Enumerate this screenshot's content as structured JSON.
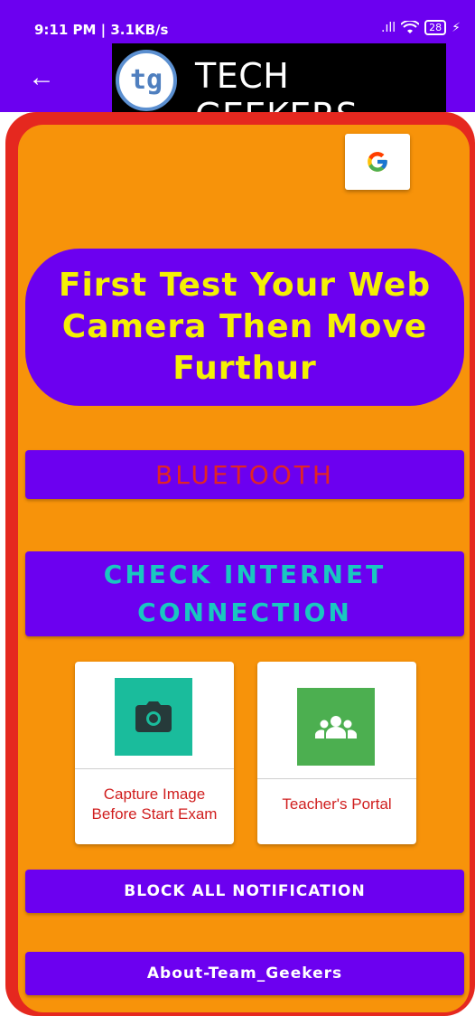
{
  "status_bar": {
    "time_info": "9:11 PM | 3.1KB/s",
    "icons_text": "෴ ◴ ··",
    "signal": ".ıll",
    "battery": "28"
  },
  "app_bar": {
    "back_icon": "←",
    "logo_mark": "tg",
    "title": "TECH GEEKERS"
  },
  "colors": {
    "primary": "#6c00f0",
    "frame_red": "#e5281f",
    "background_orange": "#f7930a",
    "banner_text": "#f4f004",
    "bluetooth_text": "#e12525",
    "internet_text": "#19c7c0",
    "camera_tile": "#1abc9c",
    "portal_tile": "#4caf50"
  },
  "main": {
    "google_icon": "google-icon",
    "banner_text": "First Test Your Web Camera Then Move Furthur",
    "bluetooth_label": "BLUETOOTH",
    "internet_label_line1": "CHECK INTERNET",
    "internet_label_line2": "CONNECTION",
    "cards": [
      {
        "icon": "camera-icon",
        "label_line1": "Capture Image",
        "label_line2": "Before Start Exam"
      },
      {
        "icon": "group-icon",
        "label_line1": "Teacher's Portal"
      }
    ],
    "block_notifications_label": "BLOCK ALL NOTIFICATION",
    "about_label": "About-Team_Geekers"
  }
}
